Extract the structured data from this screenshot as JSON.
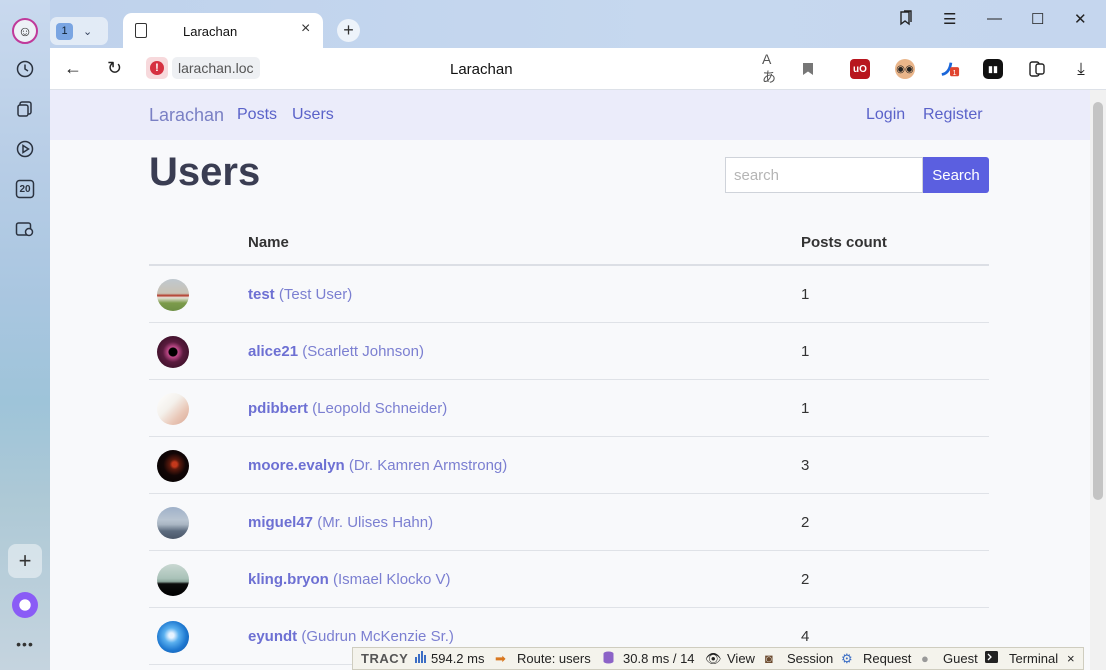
{
  "browser": {
    "tab_group_count": "1",
    "tab_title": "Larachan",
    "url": "larachan.loc",
    "page_title": "Larachan",
    "tracy": {
      "label": "TRACY",
      "time": "594.2 ms",
      "route": "Route: users",
      "db": "30.8 ms / 14",
      "view": "View",
      "session": "Session",
      "request": "Request",
      "guest": "Guest",
      "terminal": "Terminal"
    },
    "sidebar_badge": "20"
  },
  "nav": {
    "brand": "Larachan",
    "posts": "Posts",
    "users": "Users",
    "login": "Login",
    "register": "Register"
  },
  "page": {
    "heading": "Users",
    "search_placeholder": "search",
    "search_button": "Search"
  },
  "table": {
    "col_name": "Name",
    "col_posts": "Posts count",
    "rows": [
      {
        "username": "test",
        "fullname": "(Test User)",
        "count": "1"
      },
      {
        "username": "alice21",
        "fullname": "(Scarlett Johnson)",
        "count": "1"
      },
      {
        "username": "pdibbert",
        "fullname": "(Leopold Schneider)",
        "count": "1"
      },
      {
        "username": "moore.evalyn",
        "fullname": "(Dr. Kamren Armstrong)",
        "count": "3"
      },
      {
        "username": "miguel47",
        "fullname": "(Mr. Ulises Hahn)",
        "count": "2"
      },
      {
        "username": "kling.bryon",
        "fullname": "(Ismael Klocko V)",
        "count": "2"
      },
      {
        "username": "eyundt",
        "fullname": "(Gudrun McKenzie Sr.)",
        "count": "4"
      }
    ]
  }
}
